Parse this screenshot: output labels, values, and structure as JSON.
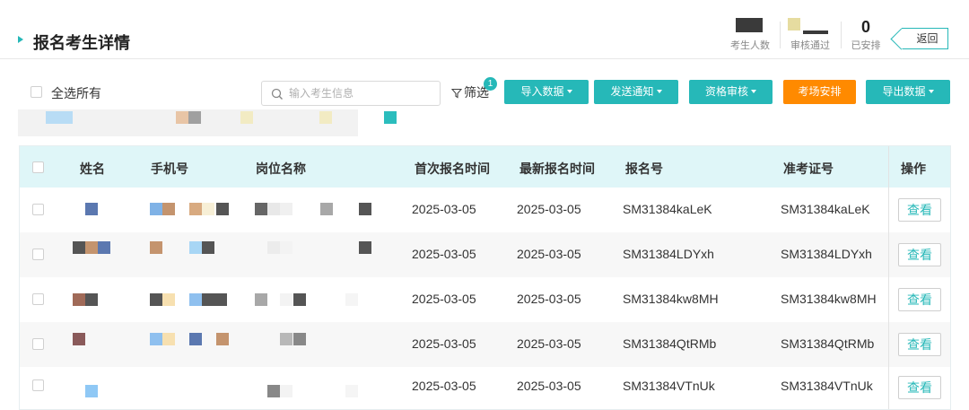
{
  "header": {
    "title": "报名考生详情",
    "back_label": "返回",
    "stats": [
      {
        "value": "",
        "label": "考生人数"
      },
      {
        "value": "",
        "label": "审核通过"
      },
      {
        "value": "0",
        "label": "已安排"
      }
    ]
  },
  "toolbar": {
    "select_all_label": "全选所有",
    "search_placeholder": "输入考生信息",
    "filter_label": "筛选",
    "filter_badge": "1",
    "buttons": [
      {
        "label": "导入数据",
        "dropdown": true,
        "color": "#26b8b8"
      },
      {
        "label": "发送通知",
        "dropdown": true,
        "color": "#26b8b8"
      },
      {
        "label": "资格审核",
        "dropdown": true,
        "color": "#26b8b8"
      },
      {
        "label": "考场安排",
        "dropdown": false,
        "color": "#ff8a00"
      },
      {
        "label": "导出数据",
        "dropdown": true,
        "color": "#26b8b8"
      }
    ]
  },
  "table": {
    "columns": [
      "姓名",
      "手机号",
      "岗位名称",
      "首次报名时间",
      "最新报名时间",
      "报名号",
      "准考证号",
      "操作"
    ],
    "rows": [
      {
        "first_time": "2025-03-05",
        "latest_time": "2025-03-05",
        "reg_no": "SM31384kaLeK",
        "ticket_no": "SM31384kaLeK",
        "action": "查看"
      },
      {
        "first_time": "2025-03-05",
        "latest_time": "2025-03-05",
        "reg_no": "SM31384LDYxh",
        "ticket_no": "SM31384LDYxh",
        "action": "查看"
      },
      {
        "first_time": "2025-03-05",
        "latest_time": "2025-03-05",
        "reg_no": "SM31384kw8MH",
        "ticket_no": "SM31384kw8MH",
        "action": "查看"
      },
      {
        "first_time": "2025-03-05",
        "latest_time": "2025-03-05",
        "reg_no": "SM31384QtRMb",
        "ticket_no": "SM31384QtRMb",
        "action": "查看"
      },
      {
        "first_time": "2025-03-05",
        "latest_time": "2025-03-05",
        "reg_no": "SM31384VTnUk",
        "ticket_no": "SM31384VTnUk",
        "action": "查看"
      }
    ]
  },
  "colors": {
    "accent": "#26b8b8",
    "warning": "#ff8a00",
    "header_bg": "#dff6f8"
  }
}
